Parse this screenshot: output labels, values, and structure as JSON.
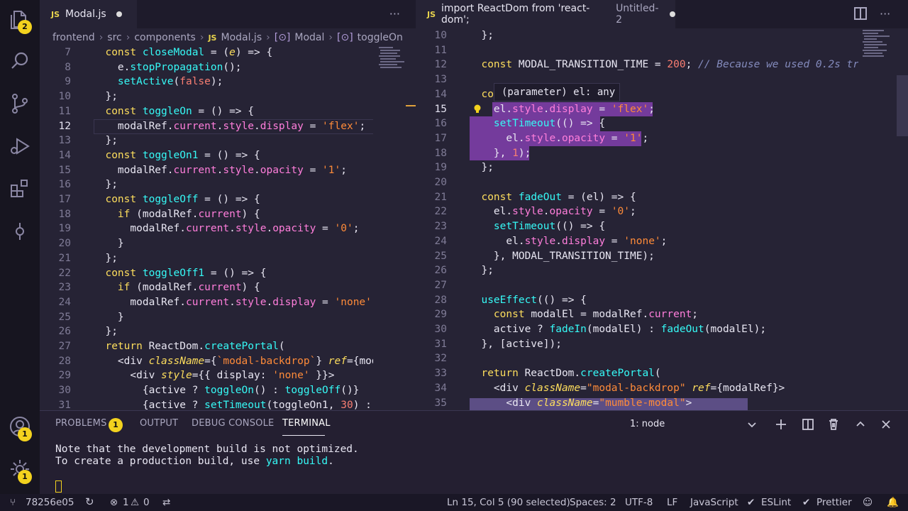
{
  "activity_bar": {
    "explorer_badge": "2",
    "accounts_badge": "1",
    "settings_badge": "1"
  },
  "left_editor": {
    "tab": {
      "lang": "JS",
      "title": "Modal.js"
    },
    "breadcrumb": [
      "frontend",
      "src",
      "components",
      "Modal.js",
      "Modal",
      "toggleOn"
    ],
    "breadcrumb_js": "JS",
    "lines": [
      {
        "n": "7"
      },
      {
        "n": "8"
      },
      {
        "n": "9"
      },
      {
        "n": "10"
      },
      {
        "n": "11"
      },
      {
        "n": "12"
      },
      {
        "n": "13"
      },
      {
        "n": "14"
      },
      {
        "n": "15"
      },
      {
        "n": "16"
      },
      {
        "n": "17"
      },
      {
        "n": "18"
      },
      {
        "n": "19"
      },
      {
        "n": "20"
      },
      {
        "n": "21"
      },
      {
        "n": "22"
      },
      {
        "n": "23"
      },
      {
        "n": "24"
      },
      {
        "n": "25"
      },
      {
        "n": "26"
      },
      {
        "n": "27"
      },
      {
        "n": "28"
      },
      {
        "n": "29"
      },
      {
        "n": "30"
      },
      {
        "n": "31"
      }
    ]
  },
  "right_editor": {
    "tab": {
      "lang": "JS",
      "title": "import ReactDom from 'react-dom';",
      "subtitle": "Untitled-2"
    },
    "tooltip": "(parameter) el: any",
    "lines": [
      {
        "n": "10"
      },
      {
        "n": "11"
      },
      {
        "n": "12"
      },
      {
        "n": "13"
      },
      {
        "n": "14"
      },
      {
        "n": "15"
      },
      {
        "n": "16"
      },
      {
        "n": "17"
      },
      {
        "n": "18"
      },
      {
        "n": "19"
      },
      {
        "n": "20"
      },
      {
        "n": "21"
      },
      {
        "n": "22"
      },
      {
        "n": "23"
      },
      {
        "n": "24"
      },
      {
        "n": "25"
      },
      {
        "n": "26"
      },
      {
        "n": "27"
      },
      {
        "n": "28"
      },
      {
        "n": "29"
      },
      {
        "n": "30"
      },
      {
        "n": "31"
      },
      {
        "n": "32"
      },
      {
        "n": "33"
      },
      {
        "n": "34"
      },
      {
        "n": "35"
      }
    ]
  },
  "panel": {
    "tabs": [
      "PROBLEMS",
      "OUTPUT",
      "DEBUG CONSOLE",
      "TERMINAL"
    ],
    "problems_badge": "1",
    "terminal_select": "1: node",
    "terminal_lines": [
      "Note that the development build is not optimized.",
      "To create a production build, use "
    ],
    "terminal_cmd": "yarn build",
    "terminal_period": "."
  },
  "status_bar": {
    "branch": "78256e05",
    "errors": "1",
    "warnings": "0",
    "position": "Ln 15, Col 5 (90 selected)",
    "spaces": "Spaces: 2",
    "encoding": "UTF-8",
    "eol": "LF",
    "language": "JavaScript",
    "eslint": "ESLint",
    "prettier": "Prettier"
  },
  "colors": {
    "background": "#262335",
    "keyword": "#fede5d",
    "function": "#36f9f6",
    "string": "#ff8b39",
    "property": "#ff7edb",
    "selection": "#b450f0",
    "badge": "#f3d21e"
  }
}
